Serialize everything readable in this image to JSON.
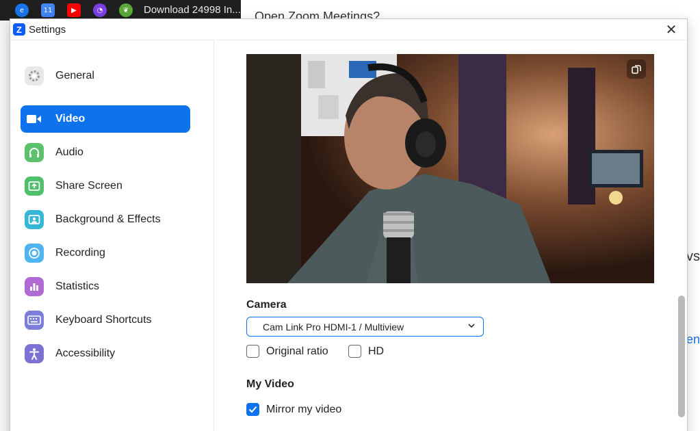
{
  "background": {
    "browser_tab_title": "Download 24998 In...",
    "page_heading_fragment": "Open Zoom Meetings?",
    "right_fragment_1": "vs",
    "right_fragment_2": "en"
  },
  "window": {
    "title": "Settings",
    "logo_letter": "Z"
  },
  "sidebar": {
    "items": [
      {
        "label": "General",
        "icon": "gear-icon",
        "color": "#e8e8e8"
      },
      {
        "label": "Video",
        "icon": "video-camera-icon",
        "color": "#0e72ed",
        "active": true
      },
      {
        "label": "Audio",
        "icon": "headphones-icon",
        "color": "#5bc16b"
      },
      {
        "label": "Share Screen",
        "icon": "share-screen-icon",
        "color": "#4fbf6a"
      },
      {
        "label": "Background & Effects",
        "icon": "background-icon",
        "color": "#37b7d6"
      },
      {
        "label": "Recording",
        "icon": "recording-icon",
        "color": "#4fb4f0"
      },
      {
        "label": "Statistics",
        "icon": "statistics-icon",
        "color": "#b06ad3"
      },
      {
        "label": "Keyboard Shortcuts",
        "icon": "keyboard-icon",
        "color": "#7b7fd8"
      },
      {
        "label": "Accessibility",
        "icon": "accessibility-icon",
        "color": "#7b72d4"
      }
    ]
  },
  "video": {
    "camera_label": "Camera",
    "camera_value": "Cam Link Pro HDMI-1 / Multiview",
    "original_ratio_label": "Original ratio",
    "hd_label": "HD",
    "my_video_label": "My Video",
    "mirror_label": "Mirror my video",
    "accent": "#0e72ed"
  }
}
